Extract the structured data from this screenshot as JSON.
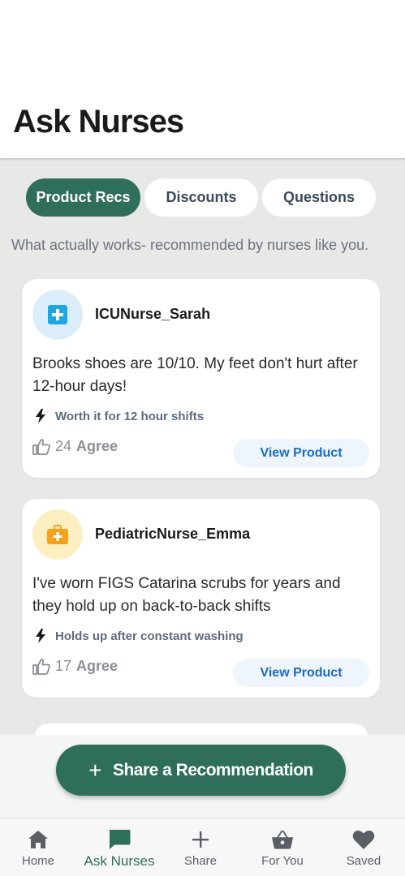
{
  "header": {
    "title": "Ask Nurses"
  },
  "tabs": [
    {
      "label": "Product Recs",
      "active": true
    },
    {
      "label": "Discounts",
      "active": false
    },
    {
      "label": "Questions",
      "active": false
    }
  ],
  "subtitle": "What actually works- recommended by nurses like you.",
  "posts": [
    {
      "username": "ICUNurse_Sarah",
      "avatar_icon": "medical-cross-icon",
      "avatar_color": "#dcedfa",
      "text": "Brooks shoes are 10/10. My feet don't hurt after 12-hour days!",
      "tag": "Worth it for 12 hour shifts",
      "agree_count": "24",
      "agree_label": "Agree",
      "button_label": "View Product"
    },
    {
      "username": "PediatricNurse_Emma",
      "avatar_icon": "medical-bag-icon",
      "avatar_color": "#fcefc2",
      "text": "I've worn FIGS Catarina scrubs for years and they hold up on back-to-back shifts",
      "tag": "Holds up after constant washing",
      "agree_count": "17",
      "agree_label": "Agree",
      "button_label": "View Product"
    }
  ],
  "share_button": {
    "label": "Share a Recommendation"
  },
  "nav": [
    {
      "label": "Home",
      "icon": "home-icon",
      "active": false
    },
    {
      "label": "Ask Nurses",
      "icon": "chat-icon",
      "active": true
    },
    {
      "label": "Share",
      "icon": "plus-icon",
      "active": false
    },
    {
      "label": "For You",
      "icon": "basket-icon",
      "active": false
    },
    {
      "label": "Saved",
      "icon": "heart-icon",
      "active": false
    }
  ],
  "colors": {
    "primary": "#2f6e5a",
    "link": "#1a6cc0",
    "background": "#e8e8e6"
  }
}
